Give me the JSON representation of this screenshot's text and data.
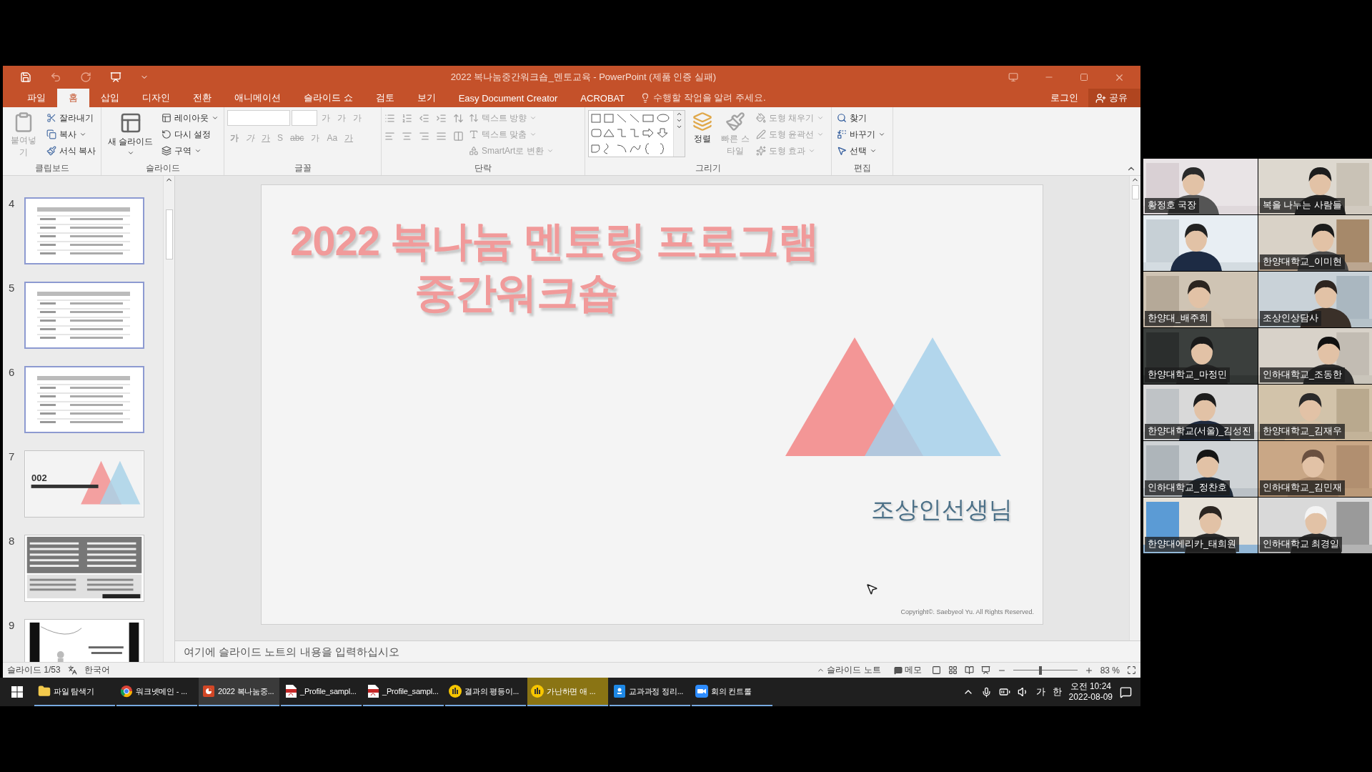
{
  "window": {
    "title": "2022 복나눔중간워크숍_멘토교육 - PowerPoint (제품 인증 실패)"
  },
  "tabs": [
    {
      "label": "파일",
      "selected": false
    },
    {
      "label": "홈",
      "selected": true
    },
    {
      "label": "삽입",
      "selected": false
    },
    {
      "label": "디자인",
      "selected": false
    },
    {
      "label": "전환",
      "selected": false
    },
    {
      "label": "애니메이션",
      "selected": false
    },
    {
      "label": "슬라이드 쇼",
      "selected": false
    },
    {
      "label": "검토",
      "selected": false
    },
    {
      "label": "보기",
      "selected": false
    },
    {
      "label": "Easy Document Creator",
      "selected": false
    },
    {
      "label": "ACROBAT",
      "selected": false
    }
  ],
  "tell_me": "수행할 작업을 알려 주세요.",
  "account": {
    "sign_in": "로그인",
    "share": "공유"
  },
  "ribbon": {
    "clipboard": {
      "label": "클립보드",
      "paste": {
        "label": "붙여넣기",
        "disabled": true
      },
      "items": [
        {
          "label": "잘라내기",
          "menu": false,
          "disabled": false
        },
        {
          "label": "복사",
          "menu": true,
          "disabled": false
        },
        {
          "label": "서식 복사",
          "menu": false,
          "disabled": false
        }
      ]
    },
    "slides": {
      "label": "슬라이드",
      "new_slide": {
        "label": "새 슬라이드",
        "menu": true
      },
      "items": [
        {
          "label": "레이아웃",
          "menu": true,
          "disabled": false
        },
        {
          "label": "다시 설정",
          "menu": false,
          "disabled": false
        },
        {
          "label": "구역",
          "menu": true,
          "disabled": false
        }
      ]
    },
    "font": {
      "label": "글꼴",
      "disabled": true,
      "row1": [
        "가",
        "가",
        "가"
      ],
      "row2": [
        "가",
        "가",
        "가",
        "S",
        "abc",
        "가",
        "Aa",
        "가"
      ]
    },
    "paragraph": {
      "label": "단락",
      "disabled": true,
      "items": [
        {
          "label": "텍스트 방향",
          "menu": true
        },
        {
          "label": "텍스트 맞춤",
          "menu": true
        },
        {
          "label": "SmartArt로 변환",
          "menu": true
        }
      ]
    },
    "drawing": {
      "label": "그리기",
      "arrange": {
        "label": "정렬",
        "disabled": false
      },
      "quick_styles": {
        "label": "빠른 스타일",
        "disabled": true
      },
      "items": [
        {
          "label": "도형 채우기",
          "disabled": true
        },
        {
          "label": "도형 윤곽선",
          "disabled": true
        },
        {
          "label": "도형 효과",
          "disabled": true
        }
      ]
    },
    "editing": {
      "label": "편집",
      "items": [
        {
          "label": "찾기",
          "menu": false,
          "disabled": false
        },
        {
          "label": "바꾸기",
          "menu": true,
          "disabled": false
        },
        {
          "label": "선택",
          "menu": true,
          "disabled": false
        }
      ]
    }
  },
  "thumbnails": [
    {
      "number": "4",
      "kind": "table",
      "selected": true
    },
    {
      "number": "5",
      "kind": "table",
      "selected": true
    },
    {
      "number": "6",
      "kind": "table",
      "selected": true
    },
    {
      "number": "7",
      "kind": "title",
      "heading": "002",
      "selected": false
    },
    {
      "number": "8",
      "kind": "text",
      "selected": false
    },
    {
      "number": "9",
      "selected": false
    }
  ],
  "slide": {
    "title_lines": [
      "2022 복나눔 멘토링 프로그램",
      "중간워크숍"
    ],
    "presenter": "조상인선생님",
    "copyright": "Copyright©. Saebyeol Yu. All Rights Reserved."
  },
  "notes": {
    "placeholder": "여기에 슬라이드 노트의 내용을 입력하십시오"
  },
  "status_bar": {
    "slide": "슬라이드 1/53",
    "language": "한국어",
    "notes": "슬라이드 노트",
    "comments": "메모",
    "zoom": "83 %",
    "level": 0.4
  },
  "participants": [
    {
      "kind": "picture",
      "name": "황정호 국장"
    },
    {
      "kind": "picture",
      "name": "복을 나누는 사람들"
    },
    {
      "kind": "picture"
    },
    {
      "kind": "picture",
      "name": "한양대학교_이미현"
    },
    {
      "kind": "picture",
      "name": "한양대_배주희"
    },
    {
      "kind": "picture",
      "name": "조상인상담사"
    },
    {
      "kind": "picture",
      "name": "한양대학교_마정민"
    },
    {
      "kind": "picture",
      "name": "인하대학교_조동한"
    },
    {
      "kind": "picture",
      "name": "한양대학교(서울)_김성진"
    },
    {
      "kind": "picture",
      "name": "한양대학교_김재우"
    },
    {
      "kind": "picture",
      "name": "인하대학교_정찬호"
    },
    {
      "kind": "picture",
      "name": "인하대학교_김민재"
    },
    {
      "kind": "picture",
      "name": "한양대에리카_태희원"
    },
    {
      "kind": "picture",
      "name": "인하대학교 최경일"
    }
  ],
  "taskbar": {
    "items": [
      {
        "label": "파일 탐색기",
        "kind": "folder",
        "flashing": false
      },
      {
        "label": "워크넷메인 - ...",
        "kind": "browser",
        "flashing": false
      },
      {
        "label": "2022 복나눔중...",
        "kind": "slides",
        "flashing": false
      },
      {
        "label": "_Profile_sampl...",
        "kind": "pdf",
        "flashing": false
      },
      {
        "label": "_Profile_sampl...",
        "kind": "pdf",
        "flashing": false
      },
      {
        "label": "결과의 평등이...",
        "kind": "doc",
        "flashing": false
      },
      {
        "label": "가난하면 애 ...",
        "kind": "doc",
        "flashing": true
      },
      {
        "label": "교과과정 정리...",
        "kind": "notes",
        "flashing": false
      },
      {
        "label": "회의 컨트롤",
        "kind": "meeting",
        "flashing": false
      }
    ],
    "ime": [
      "가",
      "한"
    ],
    "time": "오전 10:24",
    "date": "2022-08-09"
  }
}
